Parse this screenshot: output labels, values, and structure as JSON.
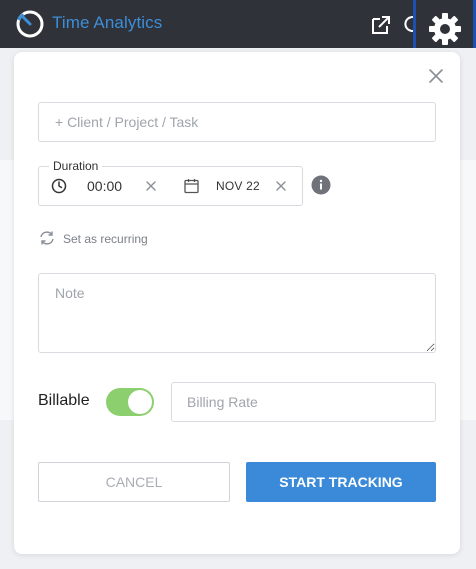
{
  "header": {
    "title": "Time Analytics",
    "icons": [
      "clock-logo-icon",
      "external-link-icon",
      "refresh-icon",
      "gear-icon"
    ]
  },
  "form": {
    "project": {
      "placeholder": "+ Client / Project / Task",
      "value": ""
    },
    "duration": {
      "legend": "Duration",
      "time": "00:00",
      "date": "NOV 22"
    },
    "recurring_label": "Set as recurring",
    "note": {
      "placeholder": "Note",
      "value": ""
    },
    "billable": {
      "label": "Billable",
      "enabled": true
    },
    "billing_rate": {
      "placeholder": "Billing Rate",
      "value": ""
    },
    "buttons": {
      "cancel": "CANCEL",
      "start": "START TRACKING"
    }
  },
  "colors": {
    "header_bg": "#2f3238",
    "brand": "#3d8ed8",
    "primary_button": "#3b8ad9",
    "toggle_on": "#8ccf6f",
    "gear_focus_border": "#1e4fb5"
  }
}
